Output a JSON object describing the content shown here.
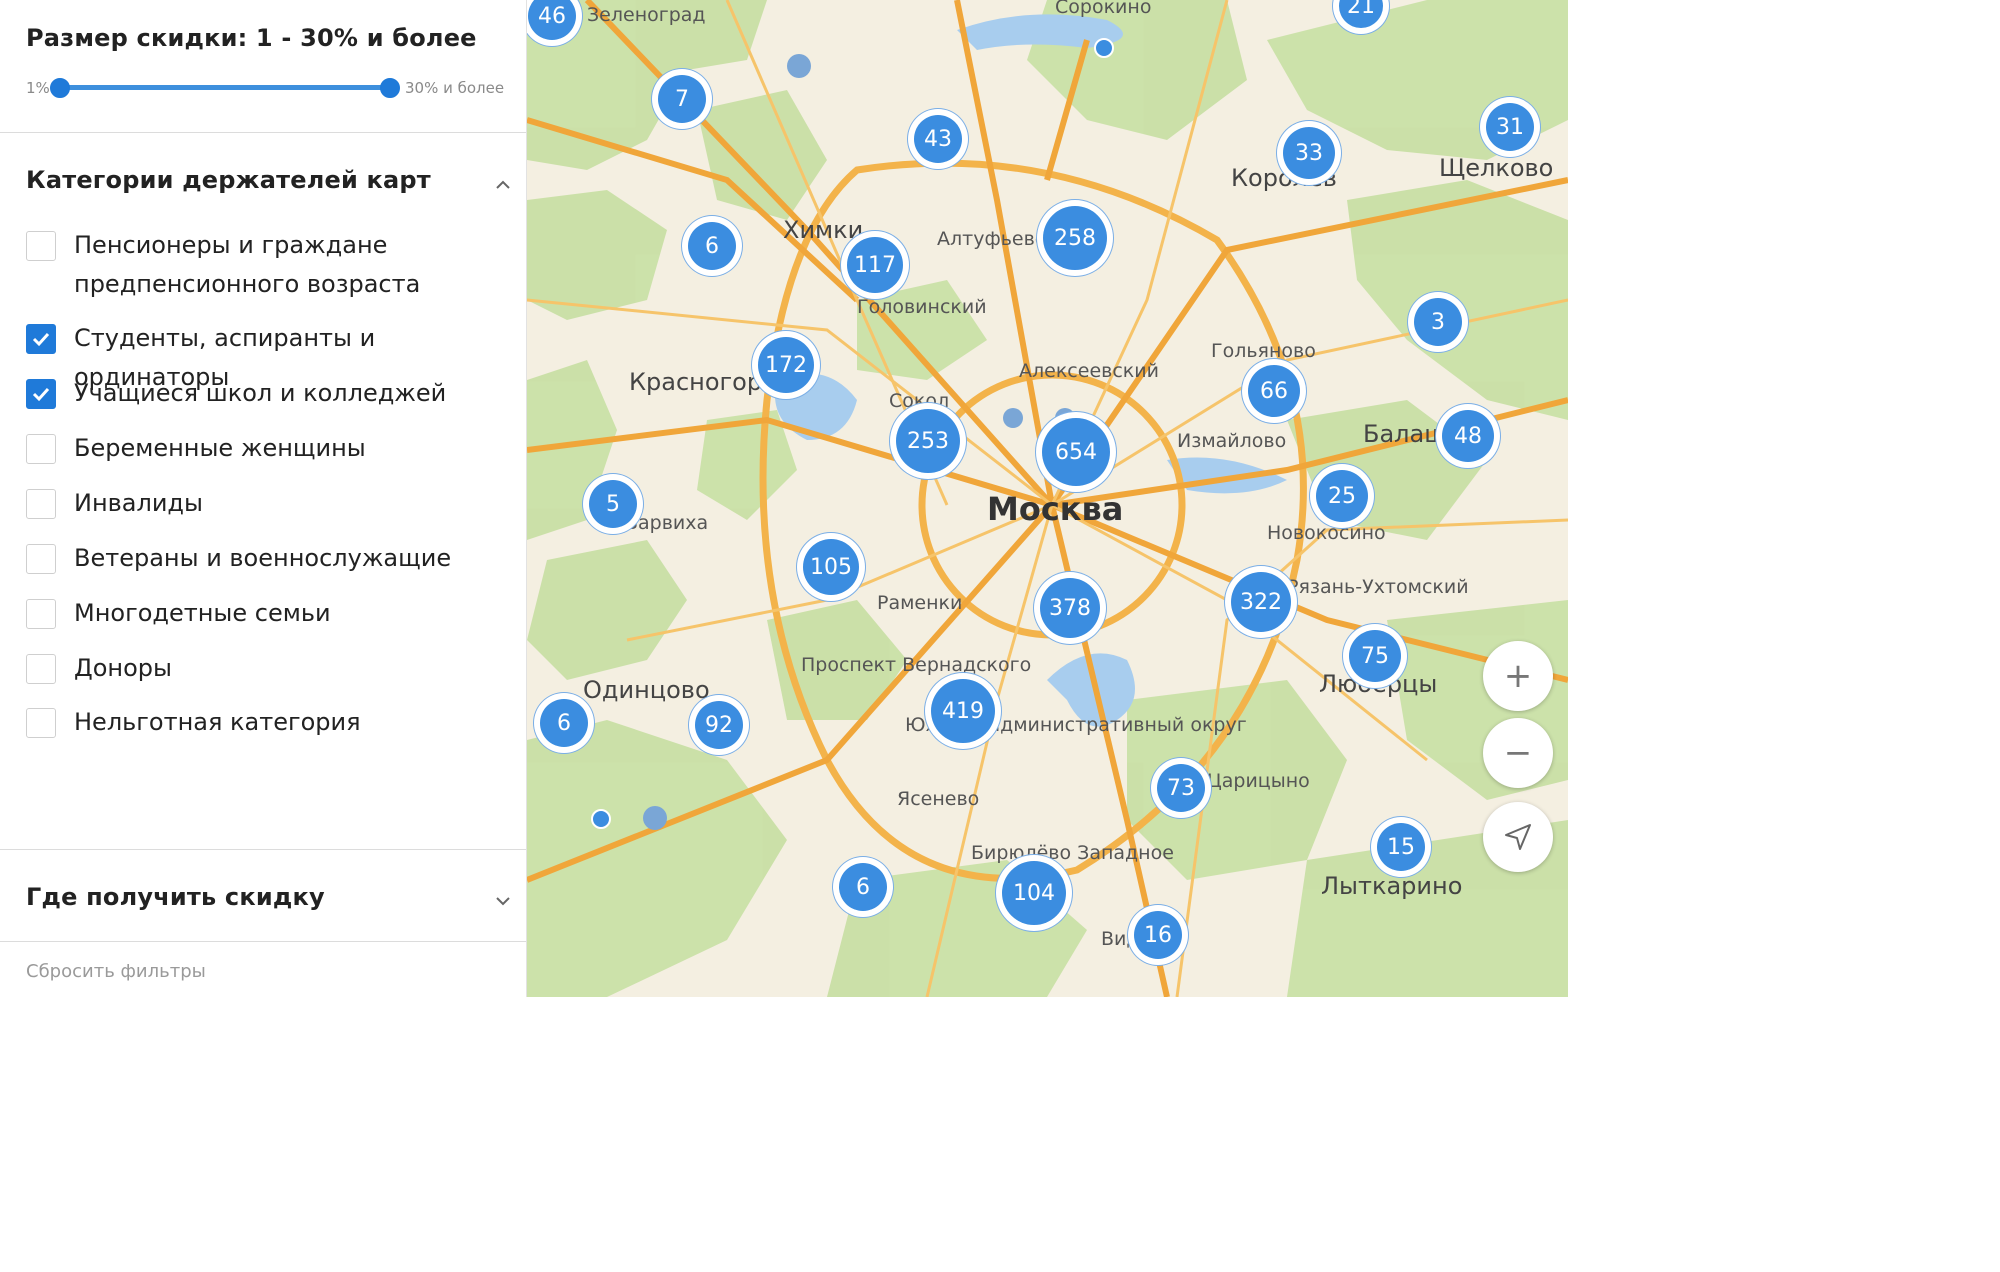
{
  "discount": {
    "title": "Размер скидки: 1 - 30% и более",
    "min_label": "1%",
    "max_label": "30% и более",
    "range_fraction": [
      0.0,
      1.0
    ]
  },
  "categories": {
    "title": "Категории держателей карт",
    "items": [
      {
        "label_lines": [
          "Пенсионеры и граждане",
          "предпенсионного возраста"
        ],
        "checked": false
      },
      {
        "label_lines": [
          "Студенты, аспиранты и ординаторы"
        ],
        "checked": true
      },
      {
        "label_lines": [
          "Учащиеся школ и колледжей"
        ],
        "checked": true
      },
      {
        "label_lines": [
          "Беременные женщины"
        ],
        "checked": false
      },
      {
        "label_lines": [
          "Инвалиды"
        ],
        "checked": false
      },
      {
        "label_lines": [
          "Ветераны и военнослужащие"
        ],
        "checked": false
      },
      {
        "label_lines": [
          "Многодетные семьи"
        ],
        "checked": false
      },
      {
        "label_lines": [
          "Доноры"
        ],
        "checked": false
      },
      {
        "label_lines": [
          "Нельготная категория"
        ],
        "checked": false
      }
    ]
  },
  "where": {
    "title": "Где получить скидку"
  },
  "reset_label": "Сбросить фильтры",
  "map": {
    "places": [
      "Москва",
      "Химки",
      "Красногорск",
      "Одинцово",
      "Королёв",
      "Щелково",
      "Люберцы",
      "Лыткарино",
      "Балаш",
      "Сорокино",
      "Алтуфьево",
      "Головинский",
      "Алексеевский",
      "Гольяново",
      "Сокол",
      "Измайлово",
      "Новокосино",
      "Раменки",
      "Проспект Вернадского",
      "Рязань-Ухтомский",
      "Южный административный округ",
      "Ясенево",
      "Бирюлёво Западное",
      "Барвиха",
      "Видное",
      "Царицыно",
      "Зеленоград"
    ],
    "clusters": [
      "46",
      "21",
      "7",
      "43",
      "33",
      "31",
      "6",
      "117",
      "258",
      "3",
      "172",
      "66",
      "253",
      "654",
      "48",
      "5",
      "25",
      "105",
      "378",
      "322",
      "75",
      "6",
      "92",
      "419",
      "73",
      "15",
      "6",
      "104",
      "16"
    ],
    "zoom_in": "+",
    "zoom_out": "−",
    "accent": "#3b8de0"
  }
}
